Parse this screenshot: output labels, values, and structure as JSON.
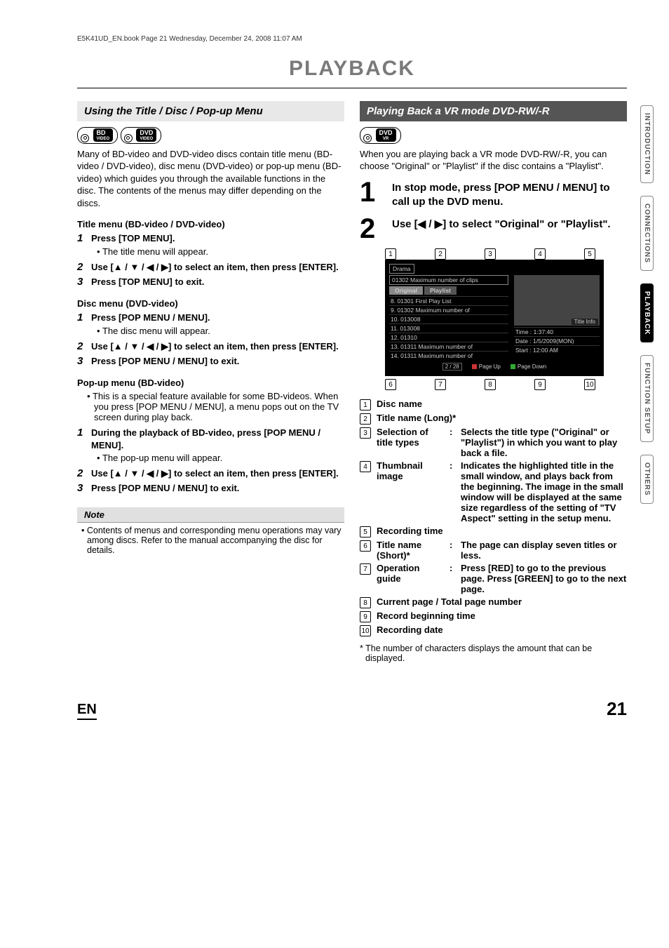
{
  "meta": {
    "header_line": "E5K41UD_EN.book  Page 21  Wednesday, December 24, 2008  11:07 AM",
    "page_title": "PLAYBACK",
    "lang": "EN",
    "page_number": "21"
  },
  "side_tabs": [
    "INTRODUCTION",
    "CONNECTIONS",
    "PLAYBACK",
    "FUNCTION SETUP",
    "OTHERS"
  ],
  "left": {
    "section_title": "Using the Title / Disc / Pop-up Menu",
    "badges": {
      "bd_main": "BD",
      "bd_sub": "VIDEO",
      "dvd_main": "DVD",
      "dvd_sub": "VIDEO"
    },
    "intro": "Many of BD-video and DVD-video discs contain title menu (BD-video / DVD-video), disc menu (DVD-video) or pop-up menu (BD-video) which guides you through the available functions in the disc. The contents of the menus may differ depending on the discs.",
    "title_menu_head": "Title menu (BD-video / DVD-video)",
    "title_steps": {
      "s1": "Press [TOP MENU].",
      "s1_bullet": "The title menu will appear.",
      "s2": "Use [▲ / ▼ / ◀ / ▶] to select an item, then press [ENTER].",
      "s3": "Press [TOP MENU] to exit."
    },
    "disc_menu_head": "Disc menu (DVD-video)",
    "disc_steps": {
      "s1": "Press [POP MENU / MENU].",
      "s1_bullet": "The disc menu will appear.",
      "s2": "Use [▲ / ▼ / ◀ / ▶] to select an item, then press [ENTER].",
      "s3": "Press [POP MENU / MENU] to exit."
    },
    "popup_head": "Pop-up menu (BD-video)",
    "popup_intro": "This is a special feature available for some BD-videos. When you press [POP MENU / MENU], a menu pops out on the TV screen during play back.",
    "popup_steps": {
      "s1": "During the playback of BD-video, press [POP MENU / MENU].",
      "s1_bullet": "The pop-up menu will appear.",
      "s2": "Use [▲ / ▼ / ◀ / ▶] to select an item, then press [ENTER].",
      "s3": "Press [POP MENU / MENU] to exit."
    },
    "note_head": "Note",
    "note_body": "Contents of menus and corresponding menu operations may vary among discs. Refer to the manual accompanying the disc for details."
  },
  "right": {
    "section_title": "Playing Back a VR mode DVD-RW/-R",
    "badge": {
      "dvd_main": "DVD",
      "dvd_sub": "VR"
    },
    "intro": "When you are playing back a VR mode DVD-RW/-R, you can choose \"Original\" or \"Playlist\" if the disc contains a \"Playlist\".",
    "big_steps": {
      "s1": "In stop mode, press [POP MENU / MENU] to call up the DVD menu.",
      "s2": "Use [◀ / ▶] to select \"Original\" or \"Playlist\"."
    },
    "dvd_menu": {
      "disc_name": "Drama",
      "title_long": "01302 Maximum number of clips",
      "tab_original": "Original",
      "tab_playlist": "Playlist",
      "list": [
        "8. 01301 First Play List",
        "9. 01302 Maximum number of",
        "10. 013008",
        "11. 013008",
        "12. 01310",
        "13. 01311 Maximum number of",
        "14. 01311 Maximum number of"
      ],
      "thumb_label": "Title Info",
      "info_time": "Time   :   1:37:40",
      "info_date": "Date   :   1/5/2009(MON)",
      "info_start": "Start   :   12:00 AM",
      "pager_count": "2 / 28",
      "page_up": "Page Up",
      "page_down": "Page Down",
      "callouts_top": [
        "1",
        "2",
        "3",
        "4",
        "5"
      ],
      "callouts_bottom": [
        "6",
        "7",
        "8",
        "9",
        "10"
      ]
    },
    "legend": {
      "i1": "Disc name",
      "i2": "Title name (Long)*",
      "i3_lbl": "Selection of title types",
      "i3_desc": "Selects the title type (\"Original\" or \"Playlist\") in which you want to play back a file.",
      "i4_lbl": "Thumbnail image",
      "i4_desc": "Indicates the highlighted title in the small window, and plays back from the beginning. The image in the small window will be displayed at the same size regardless of the setting of \"TV Aspect\" setting  in the setup menu.",
      "i5": "Recording time",
      "i6_lbl": "Title name (Short)*",
      "i6_desc": "The page can display seven titles or less.",
      "i7_lbl": "Operation guide",
      "i7_desc": "Press [RED] to go to the previous page. Press [GREEN] to go to the next page.",
      "i8": "Current page / Total page number",
      "i9": "Record beginning time",
      "i10": "Recording date"
    },
    "footnote": "* The number of characters displays the amount that can be displayed."
  }
}
